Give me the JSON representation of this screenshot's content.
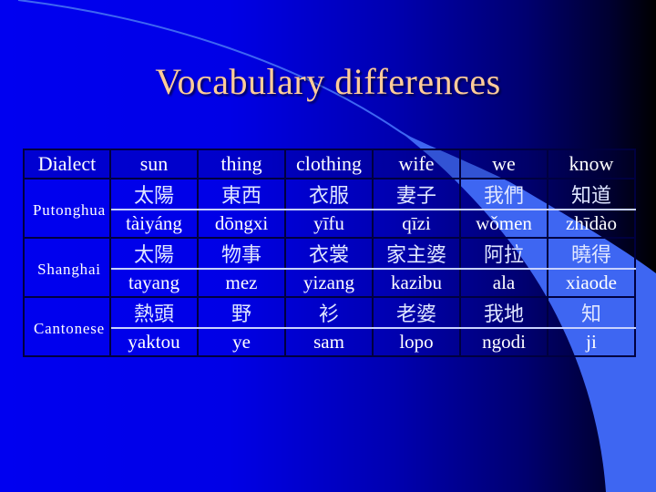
{
  "slide": {
    "title": "Vocabulary differences",
    "colors": {
      "title": "#ffcc99",
      "text": "#ffffff",
      "accent_swoosh": "#3e66f2",
      "background_left": "#0000f0",
      "background_right": "#000000"
    }
  },
  "table": {
    "header": [
      "Dialect",
      "sun",
      "thing",
      "clothing",
      "wife",
      "we",
      "know"
    ],
    "rows": [
      {
        "dialect": "Putonghua",
        "characters": [
          "太陽",
          "東西",
          "衣服",
          "妻子",
          "我們",
          "知道"
        ],
        "romanization": [
          "tàiyáng",
          "dōngxi",
          "yīfu",
          "qīzi",
          "wǒmen",
          "zhīdào"
        ]
      },
      {
        "dialect": "Shanghai",
        "characters": [
          "太陽",
          "物事",
          "衣裳",
          "家主婆",
          "阿拉",
          "曉得"
        ],
        "romanization": [
          "tayang",
          "mez",
          "yizang",
          "kazibu",
          "ala",
          "xiaode"
        ]
      },
      {
        "dialect": "Cantonese",
        "characters": [
          "熱頭",
          "野",
          "衫",
          "老婆",
          "我地",
          "知"
        ],
        "romanization": [
          "yaktou",
          "ye",
          "sam",
          "lopo",
          "ngodi",
          "ji"
        ]
      }
    ]
  }
}
